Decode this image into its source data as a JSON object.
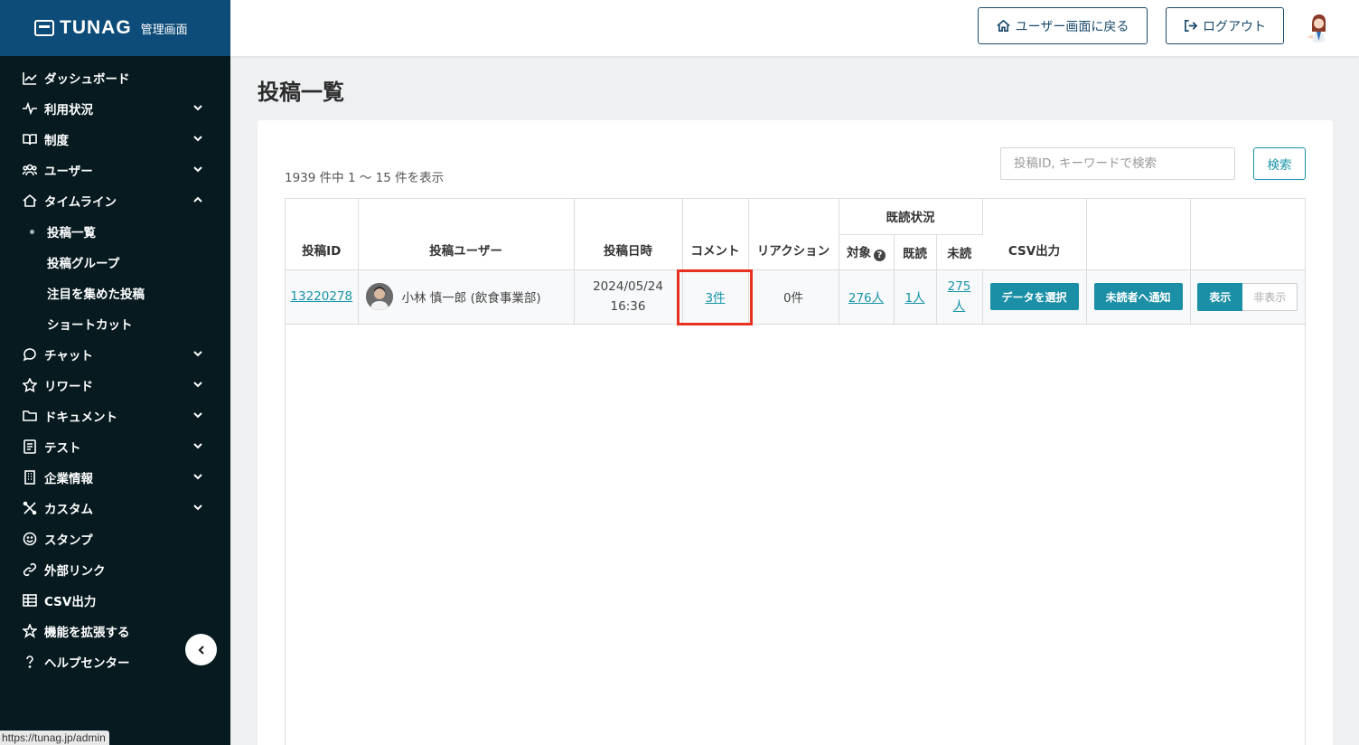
{
  "brand": {
    "name": "TUNAG",
    "sub": "管理画面"
  },
  "sidebar": {
    "items": [
      {
        "label": "ダッシュボード",
        "icon": "chart-line-icon",
        "chevron": false
      },
      {
        "label": "利用状況",
        "icon": "pulse-icon",
        "chevron": "down"
      },
      {
        "label": "制度",
        "icon": "book-icon",
        "chevron": "down"
      },
      {
        "label": "ユーザー",
        "icon": "users-icon",
        "chevron": "down"
      },
      {
        "label": "タイムライン",
        "icon": "home-icon",
        "chevron": "up"
      },
      {
        "label": "チャット",
        "icon": "chat-icon",
        "chevron": "down"
      },
      {
        "label": "リワード",
        "icon": "star-icon",
        "chevron": "down"
      },
      {
        "label": "ドキュメント",
        "icon": "folder-icon",
        "chevron": "down"
      },
      {
        "label": "テスト",
        "icon": "test-icon",
        "chevron": "down"
      },
      {
        "label": "企業情報",
        "icon": "building-icon",
        "chevron": "down"
      },
      {
        "label": "カスタム",
        "icon": "tools-icon",
        "chevron": "down"
      },
      {
        "label": "スタンプ",
        "icon": "smile-icon",
        "chevron": false
      },
      {
        "label": "外部リンク",
        "icon": "link-icon",
        "chevron": false
      },
      {
        "label": "CSV出力",
        "icon": "table-icon",
        "chevron": false
      },
      {
        "label": "機能を拡張する",
        "icon": "extend-icon",
        "chevron": false
      },
      {
        "label": "ヘルプセンター",
        "icon": "help-icon",
        "chevron": false
      }
    ],
    "timeline_sub": [
      {
        "label": "投稿一覧",
        "active": true
      },
      {
        "label": "投稿グループ",
        "active": false
      },
      {
        "label": "注目を集めた投稿",
        "active": false
      },
      {
        "label": "ショートカット",
        "active": false
      }
    ]
  },
  "status_url": "https://tunag.jp/admin",
  "header": {
    "user_screen_button": "ユーザー画面に戻る",
    "logout_button": "ログアウト"
  },
  "page": {
    "title": "投稿一覧"
  },
  "list": {
    "count_text": "1939 件中 1 〜 15 件を表示",
    "search_placeholder": "投稿ID, キーワードで検索",
    "search_button": "検索"
  },
  "table": {
    "headers": {
      "post_id": "投稿ID",
      "post_user": "投稿ユーザー",
      "post_date": "投稿日時",
      "comment": "コメント",
      "reaction": "リアクション",
      "read_status": "既読状況",
      "target": "対象",
      "read": "既読",
      "unread": "未読",
      "csv": "CSV出力"
    },
    "rows": [
      {
        "id": "13220278",
        "user": "小林 慎一郎 (飲食事業部)",
        "date": "2024/05/24",
        "time": "16:36",
        "comments": "3件",
        "reactions": "0件",
        "target": "276人",
        "read": "1人",
        "unread_num": "275",
        "unread_unit": "人",
        "csv_button": "データを選択",
        "notify_button": "未読者へ通知",
        "show_label": "表示",
        "hide_label": "非表示"
      }
    ]
  },
  "colors": {
    "accent": "#1b8fa6",
    "brand": "#0d4c79",
    "sidebar": "#061a1f",
    "highlight": "#e8321f"
  }
}
